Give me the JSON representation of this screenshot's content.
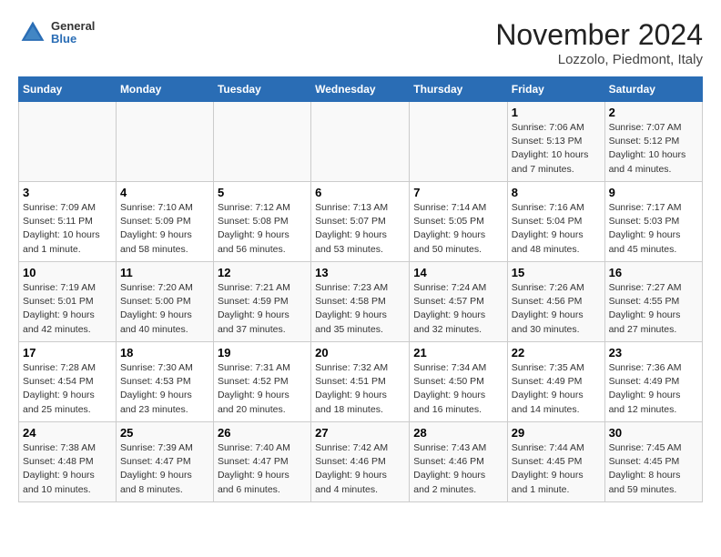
{
  "header": {
    "logo_general": "General",
    "logo_blue": "Blue",
    "month": "November 2024",
    "location": "Lozzolo, Piedmont, Italy"
  },
  "weekdays": [
    "Sunday",
    "Monday",
    "Tuesday",
    "Wednesday",
    "Thursday",
    "Friday",
    "Saturday"
  ],
  "weeks": [
    [
      {
        "day": "",
        "info": ""
      },
      {
        "day": "",
        "info": ""
      },
      {
        "day": "",
        "info": ""
      },
      {
        "day": "",
        "info": ""
      },
      {
        "day": "",
        "info": ""
      },
      {
        "day": "1",
        "info": "Sunrise: 7:06 AM\nSunset: 5:13 PM\nDaylight: 10 hours and 7 minutes."
      },
      {
        "day": "2",
        "info": "Sunrise: 7:07 AM\nSunset: 5:12 PM\nDaylight: 10 hours and 4 minutes."
      }
    ],
    [
      {
        "day": "3",
        "info": "Sunrise: 7:09 AM\nSunset: 5:11 PM\nDaylight: 10 hours and 1 minute."
      },
      {
        "day": "4",
        "info": "Sunrise: 7:10 AM\nSunset: 5:09 PM\nDaylight: 9 hours and 58 minutes."
      },
      {
        "day": "5",
        "info": "Sunrise: 7:12 AM\nSunset: 5:08 PM\nDaylight: 9 hours and 56 minutes."
      },
      {
        "day": "6",
        "info": "Sunrise: 7:13 AM\nSunset: 5:07 PM\nDaylight: 9 hours and 53 minutes."
      },
      {
        "day": "7",
        "info": "Sunrise: 7:14 AM\nSunset: 5:05 PM\nDaylight: 9 hours and 50 minutes."
      },
      {
        "day": "8",
        "info": "Sunrise: 7:16 AM\nSunset: 5:04 PM\nDaylight: 9 hours and 48 minutes."
      },
      {
        "day": "9",
        "info": "Sunrise: 7:17 AM\nSunset: 5:03 PM\nDaylight: 9 hours and 45 minutes."
      }
    ],
    [
      {
        "day": "10",
        "info": "Sunrise: 7:19 AM\nSunset: 5:01 PM\nDaylight: 9 hours and 42 minutes."
      },
      {
        "day": "11",
        "info": "Sunrise: 7:20 AM\nSunset: 5:00 PM\nDaylight: 9 hours and 40 minutes."
      },
      {
        "day": "12",
        "info": "Sunrise: 7:21 AM\nSunset: 4:59 PM\nDaylight: 9 hours and 37 minutes."
      },
      {
        "day": "13",
        "info": "Sunrise: 7:23 AM\nSunset: 4:58 PM\nDaylight: 9 hours and 35 minutes."
      },
      {
        "day": "14",
        "info": "Sunrise: 7:24 AM\nSunset: 4:57 PM\nDaylight: 9 hours and 32 minutes."
      },
      {
        "day": "15",
        "info": "Sunrise: 7:26 AM\nSunset: 4:56 PM\nDaylight: 9 hours and 30 minutes."
      },
      {
        "day": "16",
        "info": "Sunrise: 7:27 AM\nSunset: 4:55 PM\nDaylight: 9 hours and 27 minutes."
      }
    ],
    [
      {
        "day": "17",
        "info": "Sunrise: 7:28 AM\nSunset: 4:54 PM\nDaylight: 9 hours and 25 minutes."
      },
      {
        "day": "18",
        "info": "Sunrise: 7:30 AM\nSunset: 4:53 PM\nDaylight: 9 hours and 23 minutes."
      },
      {
        "day": "19",
        "info": "Sunrise: 7:31 AM\nSunset: 4:52 PM\nDaylight: 9 hours and 20 minutes."
      },
      {
        "day": "20",
        "info": "Sunrise: 7:32 AM\nSunset: 4:51 PM\nDaylight: 9 hours and 18 minutes."
      },
      {
        "day": "21",
        "info": "Sunrise: 7:34 AM\nSunset: 4:50 PM\nDaylight: 9 hours and 16 minutes."
      },
      {
        "day": "22",
        "info": "Sunrise: 7:35 AM\nSunset: 4:49 PM\nDaylight: 9 hours and 14 minutes."
      },
      {
        "day": "23",
        "info": "Sunrise: 7:36 AM\nSunset: 4:49 PM\nDaylight: 9 hours and 12 minutes."
      }
    ],
    [
      {
        "day": "24",
        "info": "Sunrise: 7:38 AM\nSunset: 4:48 PM\nDaylight: 9 hours and 10 minutes."
      },
      {
        "day": "25",
        "info": "Sunrise: 7:39 AM\nSunset: 4:47 PM\nDaylight: 9 hours and 8 minutes."
      },
      {
        "day": "26",
        "info": "Sunrise: 7:40 AM\nSunset: 4:47 PM\nDaylight: 9 hours and 6 minutes."
      },
      {
        "day": "27",
        "info": "Sunrise: 7:42 AM\nSunset: 4:46 PM\nDaylight: 9 hours and 4 minutes."
      },
      {
        "day": "28",
        "info": "Sunrise: 7:43 AM\nSunset: 4:46 PM\nDaylight: 9 hours and 2 minutes."
      },
      {
        "day": "29",
        "info": "Sunrise: 7:44 AM\nSunset: 4:45 PM\nDaylight: 9 hours and 1 minute."
      },
      {
        "day": "30",
        "info": "Sunrise: 7:45 AM\nSunset: 4:45 PM\nDaylight: 8 hours and 59 minutes."
      }
    ]
  ]
}
